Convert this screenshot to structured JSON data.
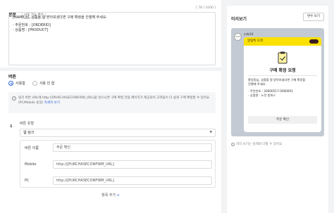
{
  "body": {
    "title": "본문",
    "variable_tag": "사용 가능 변수",
    "char_count": "[ 78 / 1000 ]",
    "lines": [
      "[NAME]님, 상품을 잘 받아보셨다면 구매 확정을 진행해 주세요.",
      "- 주문번호 : [ORDERID]",
      "- 상품명 : [PRODUCT]"
    ]
  },
  "buttons": {
    "title": "버튼",
    "radio_use": "사용함",
    "radio_no_use": "사용 안 함",
    "notice_text": "링크 버튼 URL에 http://[PURCHASECONFIRM_URL]을 넣으시면 구매 확정 전용 페이지가 제공되어 고객들이 더 쉽게 구매 확정할 수 있어요. (PC/Mobile 동일)",
    "notice_link": "자세히 보기",
    "row_number": "1",
    "type_label": "버튼 유형",
    "type_value": "웹 링크",
    "name_label": "버튼 이름",
    "name_value": "주문 확인",
    "mobile_label": "Mobile",
    "mobile_value": "http://[PURCHASECONFIRM_URL]",
    "pc_label": "PC",
    "pc_value": "http://[PURCHASECONFIRM_URL]",
    "add_label": "항목 추가"
  },
  "preview": {
    "title": "미리보기",
    "var_button": "변수 보기",
    "sender": "cafe24",
    "avatar_text": "cafe24",
    "bubble_head": "알림톡 도착",
    "bubble_title": "구매 확정 요청",
    "bubble_lines": [
      "홍길동님, 상품을 잘 받아보셨다면 구매 확정을",
      "진행해 주세요.",
      "",
      "- 주문번호 : 20600517-0000001",
      "- 상품명 : 노란 원피스"
    ],
    "bubble_button": "주문 확인",
    "note": "미리 보기는 실제와 다를 수 있어요."
  }
}
